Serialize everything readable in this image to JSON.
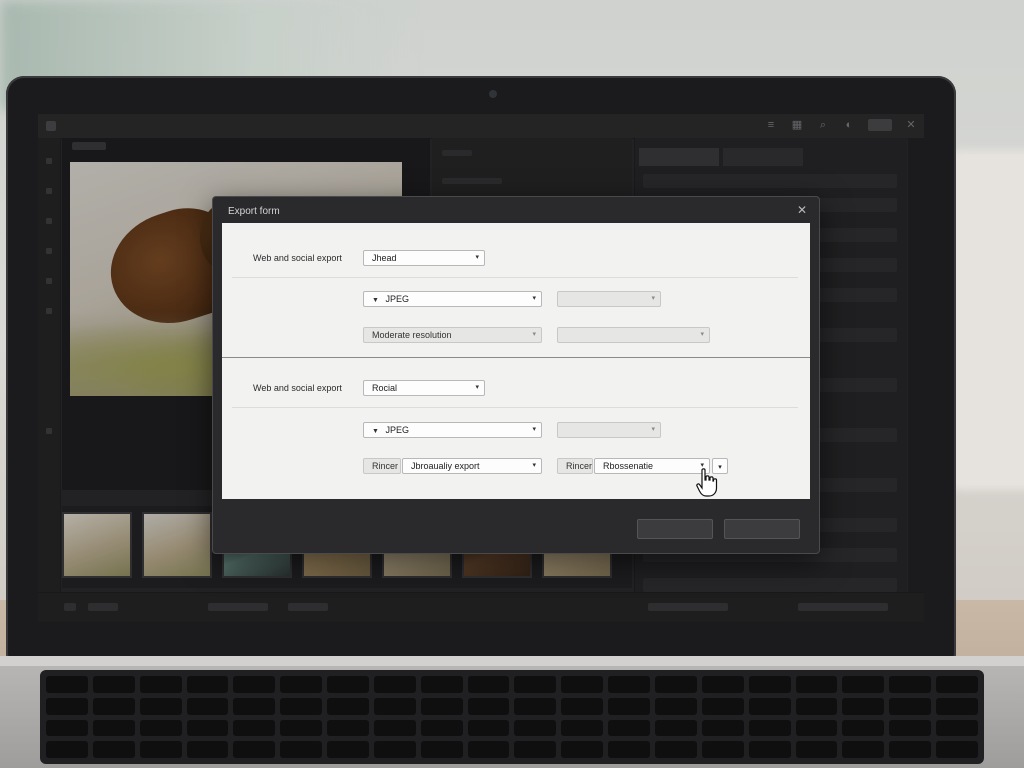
{
  "app": {
    "title": "",
    "right_panel_tabs": [
      "",
      ""
    ]
  },
  "dialog": {
    "title": "Export form",
    "sections": [
      {
        "label": "Web and social export",
        "preset_value": "Jhead",
        "format_value": "JPEG",
        "format_option_value": "",
        "resolution_value": "Moderate resolution",
        "size_value_left": "",
        "size_value_right": "",
        "extra_label": "",
        "extra_value": ""
      },
      {
        "label": "Web and social export",
        "preset_value": "Rocial",
        "format_value": "JPEG",
        "format_option_value": "",
        "resolution_value": "",
        "size_value_left": "",
        "size_value_right": "",
        "extra_label": "Rincer",
        "extra_value": "Jbroaualiy export",
        "extra2_label": "Rincer",
        "extra2_value": "Rbossenatie"
      }
    ],
    "buttons": {
      "left": "",
      "right": ""
    }
  },
  "colors": {
    "dialog_bg": "#2a2a2c",
    "dialog_body": "#f2f2f1",
    "app_bg": "#2a2a2c"
  }
}
